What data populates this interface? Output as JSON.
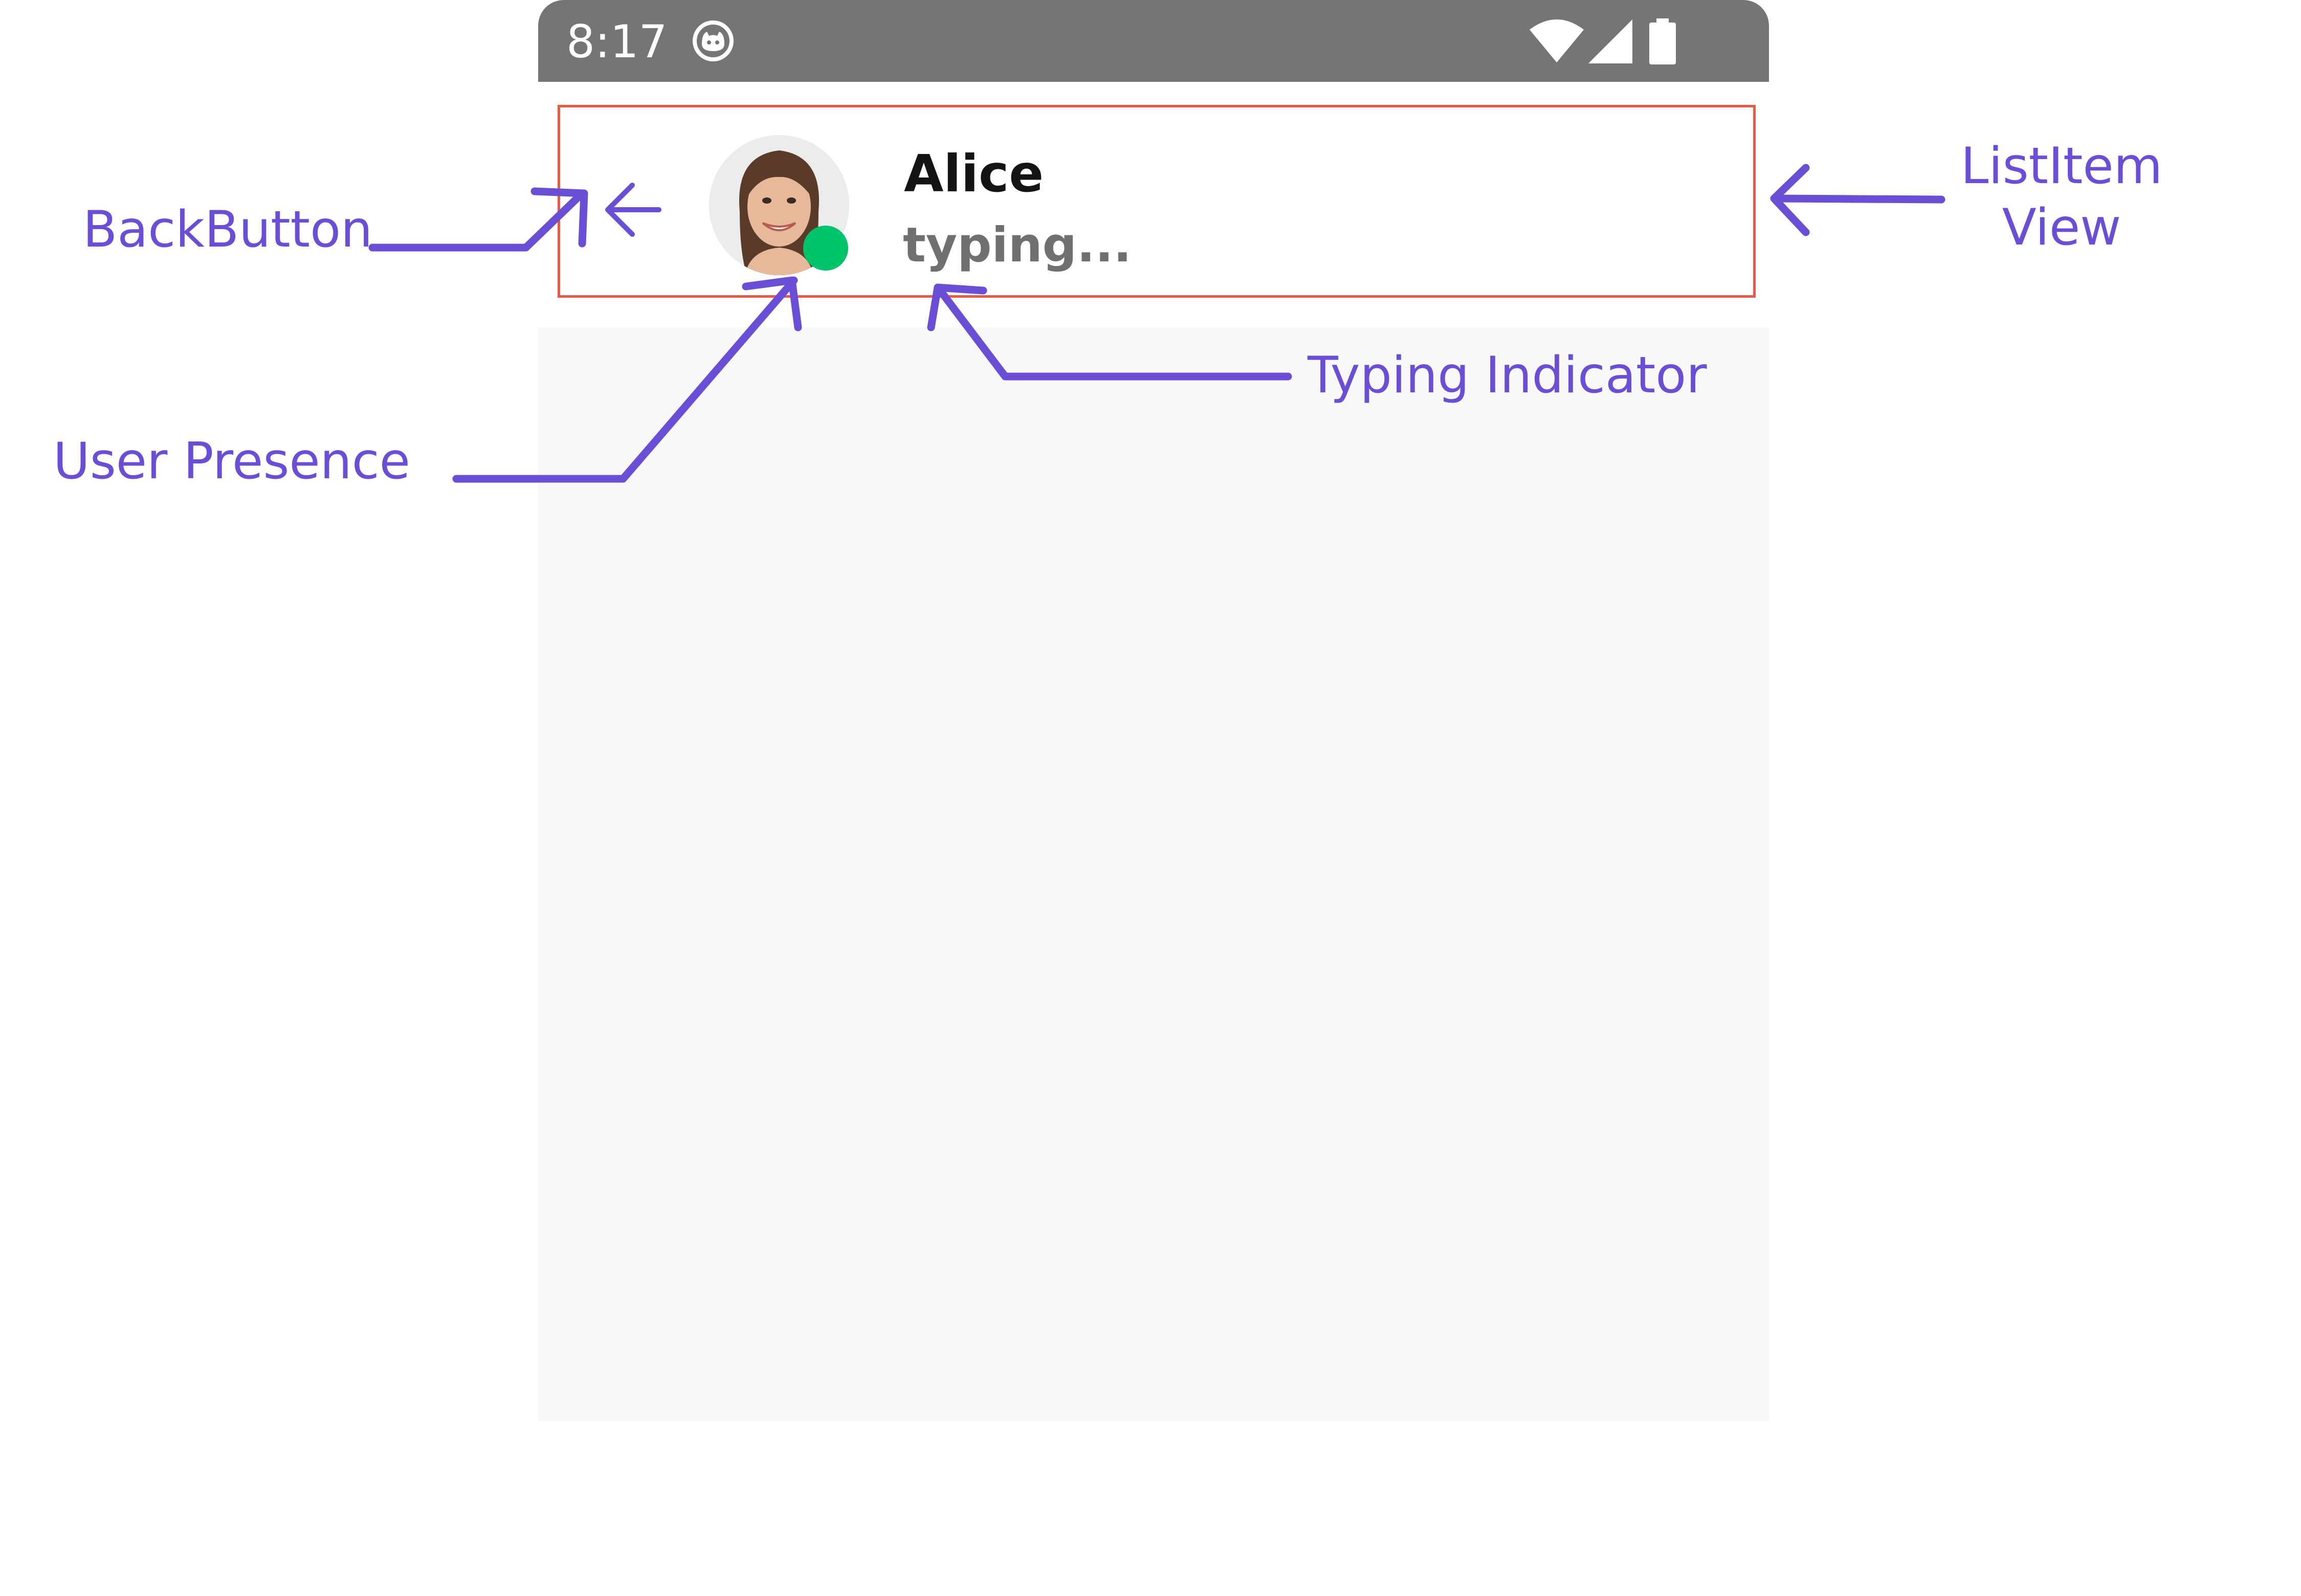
{
  "status_bar": {
    "time": "8:17",
    "icons": [
      "cat-app-icon",
      "wifi-icon",
      "cellular-signal-icon",
      "battery-icon"
    ]
  },
  "header": {
    "back_icon": "arrow-left-icon",
    "user_name": "Alice",
    "subtitle": "typing...",
    "presence": "online"
  },
  "annotations": {
    "back_button": "BackButton",
    "user_presence": "User Presence",
    "typing_indicator": "Typing Indicator",
    "listitem_line1": "ListItem",
    "listitem_line2": "View"
  },
  "colors": {
    "status_bar": "#757575",
    "annotation": "#6a4fd6",
    "presence_online": "#00c46a",
    "highlight_frame": "#e85a44",
    "content_background": "#f8f8f8"
  }
}
